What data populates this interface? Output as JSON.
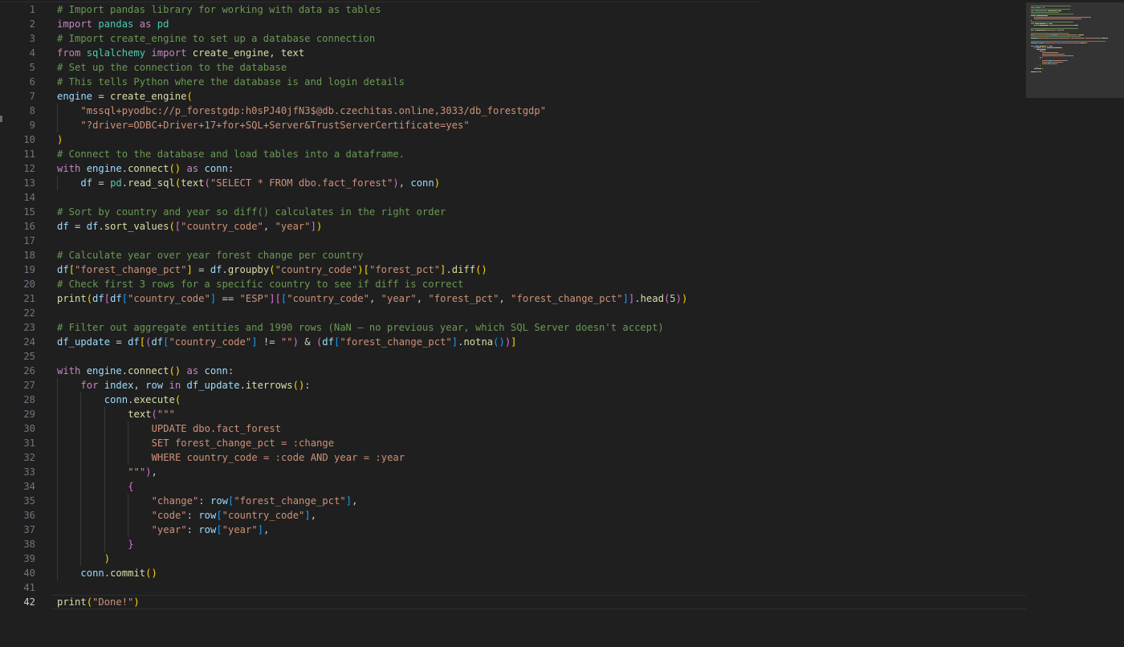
{
  "editor": {
    "language": "python",
    "current_line": 42,
    "colors": {
      "background": "#1f1f1f",
      "comment": "#6a9955",
      "keyword": "#c586c0",
      "module": "#4ec9b0",
      "variable": "#9cdcfe",
      "function": "#dcdcaa",
      "string": "#ce9178",
      "number": "#b5cea8",
      "bracket1": "#ffd700",
      "bracket2": "#da70d6",
      "bracket3": "#179fff",
      "line_number": "#6e7681"
    },
    "lines": [
      {
        "n": "1",
        "indent": 0,
        "tokens": [
          [
            "comment",
            "# Import pandas library for working with data as tables"
          ]
        ]
      },
      {
        "n": "2",
        "indent": 0,
        "tokens": [
          [
            "keyword",
            "import"
          ],
          [
            "plain",
            " "
          ],
          [
            "module",
            "pandas"
          ],
          [
            "plain",
            " "
          ],
          [
            "keyword",
            "as"
          ],
          [
            "plain",
            " "
          ],
          [
            "module",
            "pd"
          ]
        ]
      },
      {
        "n": "3",
        "indent": 0,
        "tokens": [
          [
            "comment",
            "# Import create_engine to set up a database connection"
          ]
        ]
      },
      {
        "n": "4",
        "indent": 0,
        "tokens": [
          [
            "keyword",
            "from"
          ],
          [
            "plain",
            " "
          ],
          [
            "module",
            "sqlalchemy"
          ],
          [
            "plain",
            " "
          ],
          [
            "keyword",
            "import"
          ],
          [
            "plain",
            " "
          ],
          [
            "function",
            "create_engine"
          ],
          [
            "plain",
            ", "
          ],
          [
            "function",
            "text"
          ]
        ]
      },
      {
        "n": "5",
        "indent": 0,
        "tokens": [
          [
            "comment",
            "# Set up the connection to the database"
          ]
        ]
      },
      {
        "n": "6",
        "indent": 0,
        "tokens": [
          [
            "comment",
            "# This tells Python where the database is and login details"
          ]
        ]
      },
      {
        "n": "7",
        "indent": 0,
        "tokens": [
          [
            "variable",
            "engine"
          ],
          [
            "plain",
            " = "
          ],
          [
            "function",
            "create_engine"
          ],
          [
            "bracket1",
            "("
          ]
        ]
      },
      {
        "n": "8",
        "indent": 1,
        "tokens": [
          [
            "string",
            "\"mssql+pyodbc://p_forestgdp:h0sPJ40jfN3$@db.czechitas.online,3033/db_forestgdp\""
          ]
        ]
      },
      {
        "n": "9",
        "indent": 1,
        "tokens": [
          [
            "string",
            "\"?driver=ODBC+Driver+17+for+SQL+Server&TrustServerCertificate=yes\""
          ]
        ]
      },
      {
        "n": "10",
        "indent": 0,
        "tokens": [
          [
            "bracket1",
            ")"
          ]
        ]
      },
      {
        "n": "11",
        "indent": 0,
        "tokens": [
          [
            "comment",
            "# Connect to the database and load tables into a dataframe."
          ]
        ]
      },
      {
        "n": "12",
        "indent": 0,
        "tokens": [
          [
            "keyword",
            "with"
          ],
          [
            "plain",
            " "
          ],
          [
            "variable",
            "engine"
          ],
          [
            "plain",
            "."
          ],
          [
            "function",
            "connect"
          ],
          [
            "bracket1",
            "()"
          ],
          [
            "plain",
            " "
          ],
          [
            "keyword",
            "as"
          ],
          [
            "plain",
            " "
          ],
          [
            "variable",
            "conn"
          ],
          [
            "plain",
            ":"
          ]
        ]
      },
      {
        "n": "13",
        "indent": 1,
        "tokens": [
          [
            "variable",
            "df"
          ],
          [
            "plain",
            " = "
          ],
          [
            "module",
            "pd"
          ],
          [
            "plain",
            "."
          ],
          [
            "function",
            "read_sql"
          ],
          [
            "bracket1",
            "("
          ],
          [
            "function",
            "text"
          ],
          [
            "bracket2",
            "("
          ],
          [
            "string",
            "\"SELECT * FROM dbo.fact_forest\""
          ],
          [
            "bracket2",
            ")"
          ],
          [
            "plain",
            ", "
          ],
          [
            "variable",
            "conn"
          ],
          [
            "bracket1",
            ")"
          ]
        ]
      },
      {
        "n": "14",
        "indent": 0,
        "tokens": []
      },
      {
        "n": "15",
        "indent": 0,
        "tokens": [
          [
            "comment",
            "# Sort by country and year so diff() calculates in the right order"
          ]
        ]
      },
      {
        "n": "16",
        "indent": 0,
        "tokens": [
          [
            "variable",
            "df"
          ],
          [
            "plain",
            " = "
          ],
          [
            "variable",
            "df"
          ],
          [
            "plain",
            "."
          ],
          [
            "function",
            "sort_values"
          ],
          [
            "bracket1",
            "("
          ],
          [
            "bracket2",
            "["
          ],
          [
            "string",
            "\"country_code\""
          ],
          [
            "plain",
            ", "
          ],
          [
            "string",
            "\"year\""
          ],
          [
            "bracket2",
            "]"
          ],
          [
            "bracket1",
            ")"
          ]
        ]
      },
      {
        "n": "17",
        "indent": 0,
        "tokens": []
      },
      {
        "n": "18",
        "indent": 0,
        "tokens": [
          [
            "comment",
            "# Calculate year over year forest change per country"
          ]
        ]
      },
      {
        "n": "19",
        "indent": 0,
        "tokens": [
          [
            "variable",
            "df"
          ],
          [
            "bracket1",
            "["
          ],
          [
            "string",
            "\"forest_change_pct\""
          ],
          [
            "bracket1",
            "]"
          ],
          [
            "plain",
            " = "
          ],
          [
            "variable",
            "df"
          ],
          [
            "plain",
            "."
          ],
          [
            "function",
            "groupby"
          ],
          [
            "bracket1",
            "("
          ],
          [
            "string",
            "\"country_code\""
          ],
          [
            "bracket1",
            ")"
          ],
          [
            "bracket1",
            "["
          ],
          [
            "string",
            "\"forest_pct\""
          ],
          [
            "bracket1",
            "]"
          ],
          [
            "plain",
            "."
          ],
          [
            "function",
            "diff"
          ],
          [
            "bracket1",
            "()"
          ]
        ]
      },
      {
        "n": "20",
        "indent": 0,
        "tokens": [
          [
            "comment",
            "# Check first 3 rows for a specific country to see if diff is correct"
          ]
        ]
      },
      {
        "n": "21",
        "indent": 0,
        "tokens": [
          [
            "function",
            "print"
          ],
          [
            "bracket1",
            "("
          ],
          [
            "variable",
            "df"
          ],
          [
            "bracket2",
            "["
          ],
          [
            "variable",
            "df"
          ],
          [
            "bracket3",
            "["
          ],
          [
            "string",
            "\"country_code\""
          ],
          [
            "bracket3",
            "]"
          ],
          [
            "plain",
            " == "
          ],
          [
            "string",
            "\"ESP\""
          ],
          [
            "bracket2",
            "]"
          ],
          [
            "bracket2",
            "["
          ],
          [
            "bracket3",
            "["
          ],
          [
            "string",
            "\"country_code\""
          ],
          [
            "plain",
            ", "
          ],
          [
            "string",
            "\"year\""
          ],
          [
            "plain",
            ", "
          ],
          [
            "string",
            "\"forest_pct\""
          ],
          [
            "plain",
            ", "
          ],
          [
            "string",
            "\"forest_change_pct\""
          ],
          [
            "bracket3",
            "]"
          ],
          [
            "bracket2",
            "]"
          ],
          [
            "plain",
            "."
          ],
          [
            "function",
            "head"
          ],
          [
            "bracket2",
            "("
          ],
          [
            "number",
            "5"
          ],
          [
            "bracket2",
            ")"
          ],
          [
            "bracket1",
            ")"
          ]
        ]
      },
      {
        "n": "22",
        "indent": 0,
        "tokens": []
      },
      {
        "n": "23",
        "indent": 0,
        "tokens": [
          [
            "comment",
            "# Filter out aggregate entities and 1990 rows (NaN – no previous year, which SQL Server doesn't accept)"
          ]
        ]
      },
      {
        "n": "24",
        "indent": 0,
        "tokens": [
          [
            "variable",
            "df_update"
          ],
          [
            "plain",
            " = "
          ],
          [
            "variable",
            "df"
          ],
          [
            "bracket1",
            "["
          ],
          [
            "bracket2",
            "("
          ],
          [
            "variable",
            "df"
          ],
          [
            "bracket3",
            "["
          ],
          [
            "string",
            "\"country_code\""
          ],
          [
            "bracket3",
            "]"
          ],
          [
            "plain",
            " != "
          ],
          [
            "string",
            "\"\""
          ],
          [
            "bracket2",
            ")"
          ],
          [
            "plain",
            " & "
          ],
          [
            "bracket2",
            "("
          ],
          [
            "variable",
            "df"
          ],
          [
            "bracket3",
            "["
          ],
          [
            "string",
            "\"forest_change_pct\""
          ],
          [
            "bracket3",
            "]"
          ],
          [
            "plain",
            "."
          ],
          [
            "function",
            "notna"
          ],
          [
            "bracket3",
            "()"
          ],
          [
            "bracket2",
            ")"
          ],
          [
            "bracket1",
            "]"
          ]
        ]
      },
      {
        "n": "25",
        "indent": 0,
        "tokens": []
      },
      {
        "n": "26",
        "indent": 0,
        "tokens": [
          [
            "keyword",
            "with"
          ],
          [
            "plain",
            " "
          ],
          [
            "variable",
            "engine"
          ],
          [
            "plain",
            "."
          ],
          [
            "function",
            "connect"
          ],
          [
            "bracket1",
            "()"
          ],
          [
            "plain",
            " "
          ],
          [
            "keyword",
            "as"
          ],
          [
            "plain",
            " "
          ],
          [
            "variable",
            "conn"
          ],
          [
            "plain",
            ":"
          ]
        ]
      },
      {
        "n": "27",
        "indent": 1,
        "tokens": [
          [
            "keyword",
            "for"
          ],
          [
            "plain",
            " "
          ],
          [
            "variable",
            "index"
          ],
          [
            "plain",
            ", "
          ],
          [
            "variable",
            "row"
          ],
          [
            "plain",
            " "
          ],
          [
            "keyword",
            "in"
          ],
          [
            "plain",
            " "
          ],
          [
            "variable",
            "df_update"
          ],
          [
            "plain",
            "."
          ],
          [
            "function",
            "iterrows"
          ],
          [
            "bracket1",
            "()"
          ],
          [
            "plain",
            ":"
          ]
        ]
      },
      {
        "n": "28",
        "indent": 2,
        "tokens": [
          [
            "variable",
            "conn"
          ],
          [
            "plain",
            "."
          ],
          [
            "function",
            "execute"
          ],
          [
            "bracket1",
            "("
          ]
        ]
      },
      {
        "n": "29",
        "indent": 3,
        "tokens": [
          [
            "function",
            "text"
          ],
          [
            "bracket2",
            "("
          ],
          [
            "string",
            "\"\"\""
          ]
        ]
      },
      {
        "n": "30",
        "indent": 4,
        "tokens": [
          [
            "string",
            "UPDATE dbo.fact_forest"
          ]
        ]
      },
      {
        "n": "31",
        "indent": 4,
        "tokens": [
          [
            "string",
            "SET forest_change_pct = :change"
          ]
        ]
      },
      {
        "n": "32",
        "indent": 4,
        "tokens": [
          [
            "string",
            "WHERE country_code = :code AND year = :year"
          ]
        ]
      },
      {
        "n": "33",
        "indent": 3,
        "tokens": [
          [
            "string",
            "\"\"\""
          ],
          [
            "bracket2",
            ")"
          ],
          [
            "plain",
            ","
          ]
        ]
      },
      {
        "n": "34",
        "indent": 3,
        "tokens": [
          [
            "bracket2",
            "{"
          ]
        ]
      },
      {
        "n": "35",
        "indent": 4,
        "tokens": [
          [
            "string",
            "\"change\""
          ],
          [
            "plain",
            ": "
          ],
          [
            "variable",
            "row"
          ],
          [
            "bracket3",
            "["
          ],
          [
            "string",
            "\"forest_change_pct\""
          ],
          [
            "bracket3",
            "]"
          ],
          [
            "plain",
            ","
          ]
        ]
      },
      {
        "n": "36",
        "indent": 4,
        "tokens": [
          [
            "string",
            "\"code\""
          ],
          [
            "plain",
            ": "
          ],
          [
            "variable",
            "row"
          ],
          [
            "bracket3",
            "["
          ],
          [
            "string",
            "\"country_code\""
          ],
          [
            "bracket3",
            "]"
          ],
          [
            "plain",
            ","
          ]
        ]
      },
      {
        "n": "37",
        "indent": 4,
        "tokens": [
          [
            "string",
            "\"year\""
          ],
          [
            "plain",
            ": "
          ],
          [
            "variable",
            "row"
          ],
          [
            "bracket3",
            "["
          ],
          [
            "string",
            "\"year\""
          ],
          [
            "bracket3",
            "]"
          ],
          [
            "plain",
            ","
          ]
        ]
      },
      {
        "n": "38",
        "indent": 3,
        "tokens": [
          [
            "bracket2",
            "}"
          ]
        ]
      },
      {
        "n": "39",
        "indent": 2,
        "tokens": [
          [
            "bracket1",
            ")"
          ]
        ]
      },
      {
        "n": "40",
        "indent": 1,
        "tokens": [
          [
            "variable",
            "conn"
          ],
          [
            "plain",
            "."
          ],
          [
            "function",
            "commit"
          ],
          [
            "bracket1",
            "()"
          ]
        ]
      },
      {
        "n": "41",
        "indent": 0,
        "tokens": []
      },
      {
        "n": "42",
        "indent": 0,
        "tokens": [
          [
            "function",
            "print"
          ],
          [
            "bracket1",
            "("
          ],
          [
            "string",
            "\"Done!\""
          ],
          [
            "bracket1",
            ")"
          ]
        ]
      }
    ]
  }
}
